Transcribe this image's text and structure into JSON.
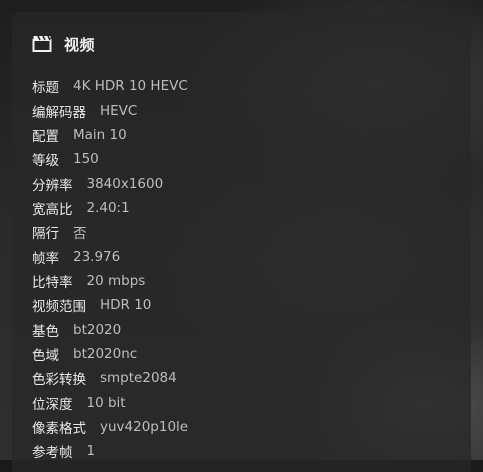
{
  "panel": {
    "title": "视频",
    "icon": "clapperboard-icon"
  },
  "rows": [
    {
      "key": "标题",
      "value": "4K HDR 10 HEVC"
    },
    {
      "key": "编解码器",
      "value": "HEVC"
    },
    {
      "key": "配置",
      "value": "Main 10"
    },
    {
      "key": "等级",
      "value": "150"
    },
    {
      "key": "分辨率",
      "value": "3840x1600"
    },
    {
      "key": "宽高比",
      "value": "2.40:1"
    },
    {
      "key": "隔行",
      "value": "否"
    },
    {
      "key": "帧率",
      "value": "23.976"
    },
    {
      "key": "比特率",
      "value": "20 mbps"
    },
    {
      "key": "视频范围",
      "value": "HDR 10"
    },
    {
      "key": "基色",
      "value": "bt2020"
    },
    {
      "key": "色域",
      "value": "bt2020nc"
    },
    {
      "key": "色彩转换",
      "value": "smpte2084"
    },
    {
      "key": "位深度",
      "value": "10 bit"
    },
    {
      "key": "像素格式",
      "value": "yuv420p10le"
    },
    {
      "key": "参考帧",
      "value": "1"
    }
  ]
}
